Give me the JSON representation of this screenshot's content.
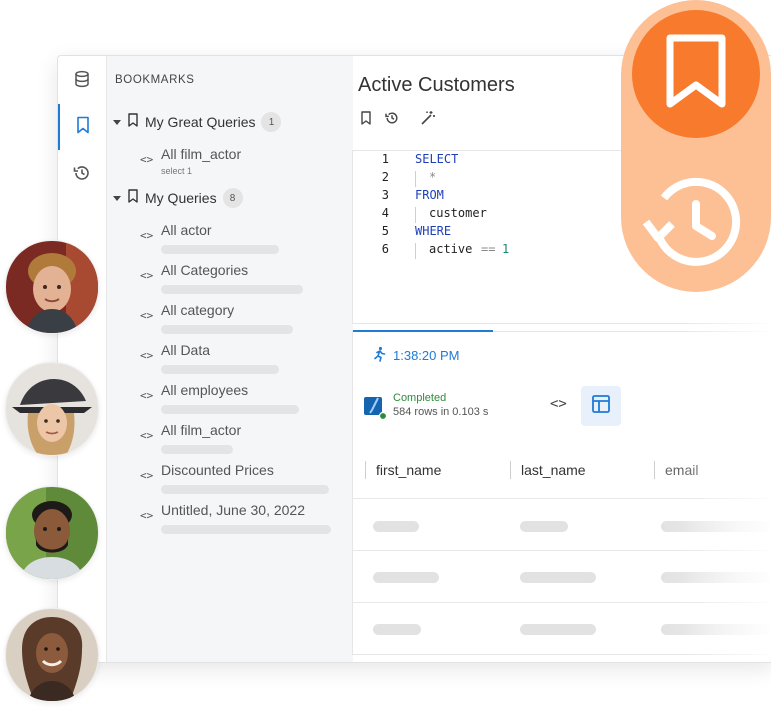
{
  "sidebar": {
    "title": "BOOKMARKS",
    "groups": [
      {
        "label": "My Great Queries",
        "count": "1",
        "items": [
          {
            "label": "All film_actor",
            "sub": "select 1"
          }
        ]
      },
      {
        "label": "My Queries",
        "count": "8",
        "items": [
          {
            "label": "All actor"
          },
          {
            "label": "All Categories"
          },
          {
            "label": "All category"
          },
          {
            "label": "All Data"
          },
          {
            "label": "All employees"
          },
          {
            "label": "All film_actor"
          },
          {
            "label": "Discounted Prices"
          },
          {
            "label": "Untitled, June 30, 2022"
          }
        ]
      }
    ]
  },
  "main": {
    "title": "Active Customers",
    "editor": {
      "line_numbers": [
        "1",
        "2",
        "3",
        "4",
        "5",
        "6"
      ],
      "lines": [
        {
          "kw": "SELECT"
        },
        {
          "plain": "*"
        },
        {
          "kw": "FROM"
        },
        {
          "plain": "customer"
        },
        {
          "kw": "WHERE"
        },
        {
          "plain": "active",
          "op": "==",
          "num": "1"
        }
      ]
    },
    "results": {
      "time": "1:38:20 PM",
      "status": "Completed",
      "rows_info": "584 rows in 0.103 s",
      "code_icon": "<>",
      "columns": [
        "first_name",
        "last_name",
        "email"
      ]
    }
  },
  "icons": {
    "code": "<>"
  },
  "colors": {
    "accent_blue": "#1e7bd6",
    "orange": "#f77a2d",
    "orange_light": "#fdbf94",
    "keyword": "#1d3fb8",
    "number": "#1d8a6d",
    "status_green": "#2e8b3a"
  }
}
